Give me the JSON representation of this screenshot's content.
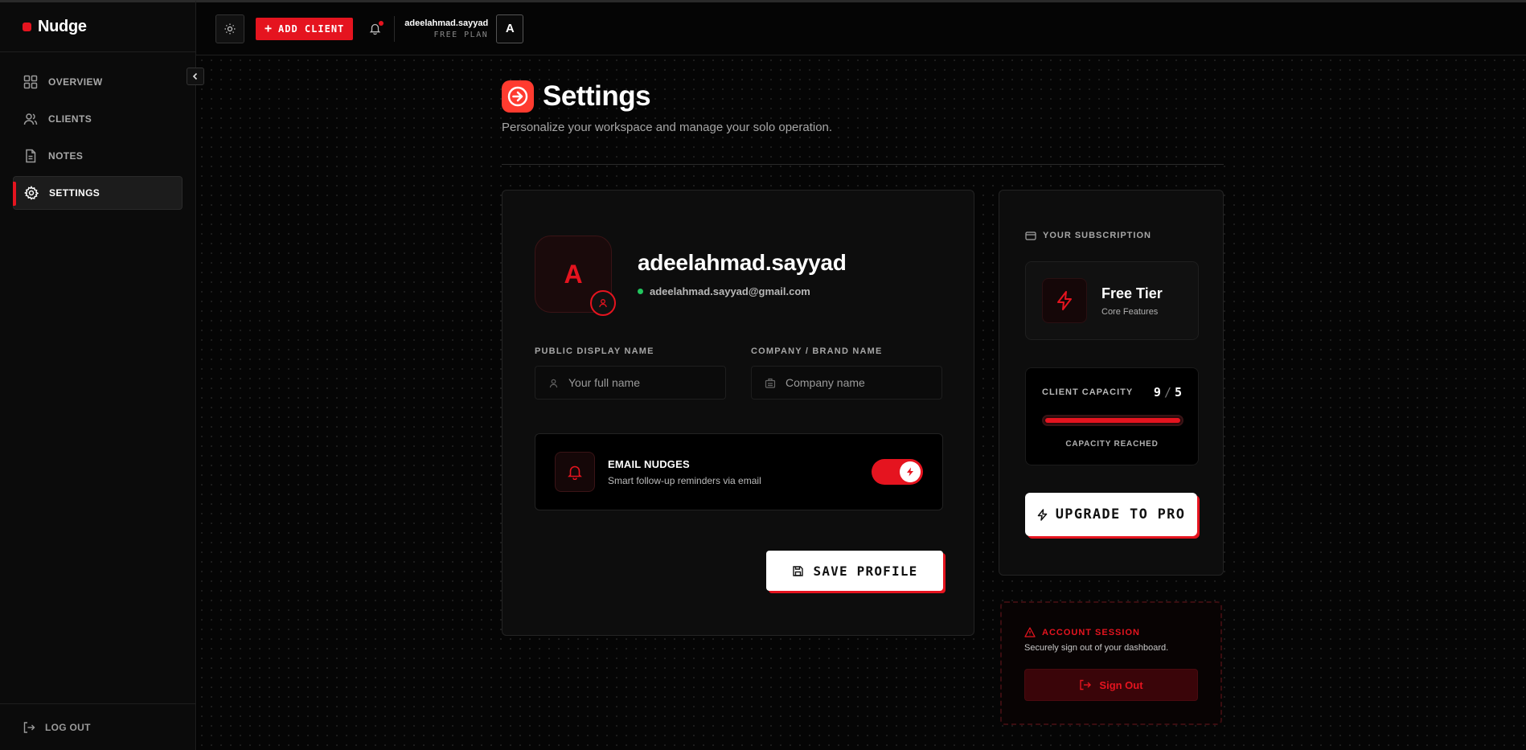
{
  "app": {
    "name": "Nudge"
  },
  "sidebar": {
    "items": [
      {
        "label": "OVERVIEW",
        "icon": "grid-icon"
      },
      {
        "label": "CLIENTS",
        "icon": "users-icon"
      },
      {
        "label": "NOTES",
        "icon": "document-icon"
      },
      {
        "label": "SETTINGS",
        "icon": "gear-icon",
        "active": true
      }
    ],
    "logout_label": "LOG OUT"
  },
  "topbar": {
    "add_client_label": "ADD CLIENT",
    "username": "adeelahmad.sayyad",
    "plan": "FREE PLAN",
    "avatar_letter": "A"
  },
  "header": {
    "title": "Settings",
    "subtitle": "Personalize your workspace and manage your solo operation."
  },
  "profile": {
    "avatar_letter": "A",
    "name": "adeelahmad.sayyad",
    "email": "adeelahmad.sayyad@gmail.com",
    "display_name_label": "PUBLIC DISPLAY NAME",
    "display_name_placeholder": "Your full name",
    "company_label": "COMPANY / BRAND NAME",
    "company_placeholder": "Company name",
    "email_nudges_title": "EMAIL NUDGES",
    "email_nudges_desc": "Smart follow-up reminders via email",
    "email_nudges_enabled": true,
    "save_label": "SAVE PROFILE"
  },
  "subscription": {
    "heading": "YOUR SUBSCRIPTION",
    "tier_name": "Free Tier",
    "tier_desc": "Core Features",
    "capacity_label": "CLIENT CAPACITY",
    "capacity_used": "9",
    "capacity_sep": "/",
    "capacity_max": "5",
    "capacity_fill_fraction": 1.0,
    "capacity_status": "CAPACITY REACHED",
    "upgrade_label": "UPGRADE TO PRO"
  },
  "session": {
    "heading": "ACCOUNT SESSION",
    "desc": "Securely sign out of your dashboard.",
    "signout_label": "Sign Out"
  },
  "colors": {
    "accent": "#e5141f",
    "title_icon": "#ff3b2f",
    "online": "#22c55e"
  }
}
